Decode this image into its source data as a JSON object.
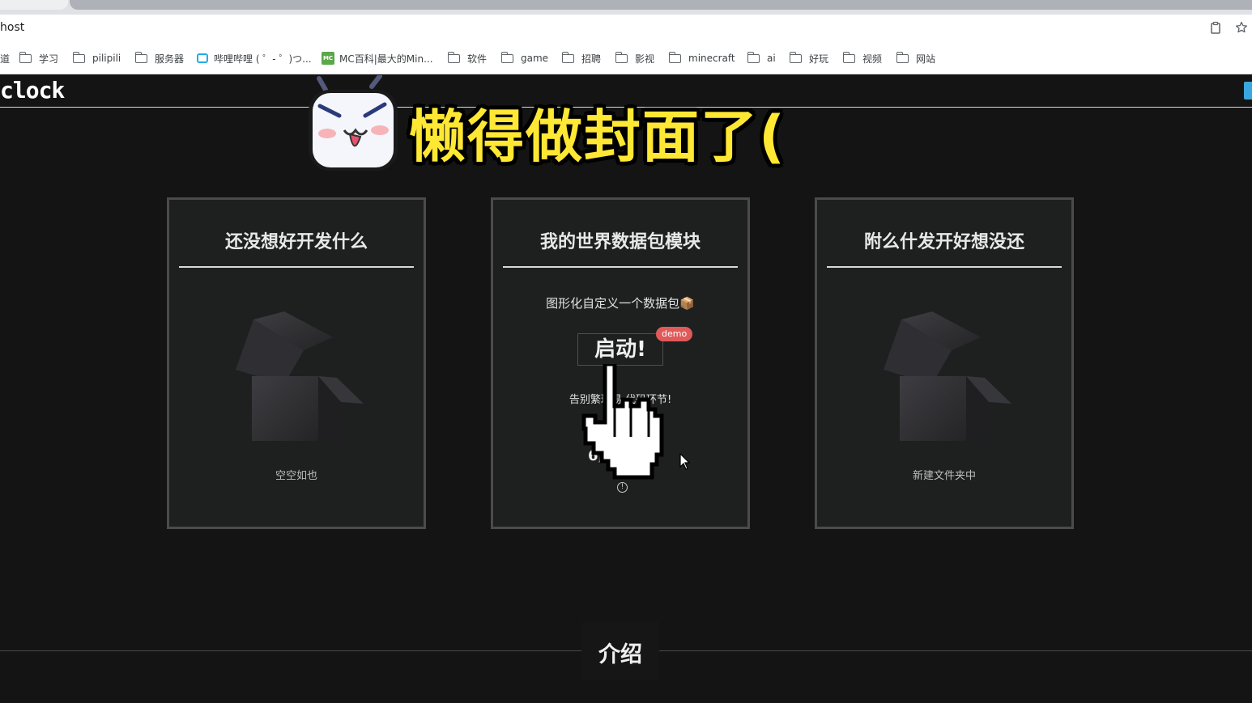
{
  "browser": {
    "url": "host",
    "bookmarks": [
      {
        "label": "道",
        "icon": "none"
      },
      {
        "label": "学习",
        "icon": "folder-icon"
      },
      {
        "label": "pilipili",
        "icon": "folder-icon"
      },
      {
        "label": "服务器",
        "icon": "folder-icon"
      },
      {
        "label": "哔哩哔哩 ( ゜- ゜)つ...",
        "icon": "bilibili-icon"
      },
      {
        "label": "MC百科|最大的Min...",
        "icon": "mc-icon"
      },
      {
        "label": "软件",
        "icon": "folder-icon"
      },
      {
        "label": "game",
        "icon": "folder-icon"
      },
      {
        "label": "招聘",
        "icon": "folder-icon"
      },
      {
        "label": "影视",
        "icon": "folder-icon"
      },
      {
        "label": "minecraft",
        "icon": "folder-icon"
      },
      {
        "label": "ai",
        "icon": "folder-icon"
      },
      {
        "label": "好玩",
        "icon": "folder-icon"
      },
      {
        "label": "视频",
        "icon": "folder-icon"
      },
      {
        "label": "网站",
        "icon": "folder-icon"
      }
    ],
    "mc_badge": "MC"
  },
  "site": {
    "logo": "clock",
    "banner": "懒得做封面了("
  },
  "cards": [
    {
      "title": "还没想好开发什么",
      "caption": "空空如也"
    },
    {
      "title": "我的世界数据包模块",
      "description": "图形化自定义一个数据包📦",
      "button": "启动!",
      "badge": "demo",
      "tagline": "告别繁琐易        代码环节!",
      "stat_label": "数",
      "stat_value": "6,",
      "info": "!"
    },
    {
      "title": "附么什发开好想没还",
      "caption": "新建文件夹中"
    }
  ],
  "intro": {
    "title": "介绍"
  },
  "colors": {
    "background": "#141414",
    "card": "#1e2020",
    "banner": "#ffe834",
    "badge": "#e05a5a"
  }
}
